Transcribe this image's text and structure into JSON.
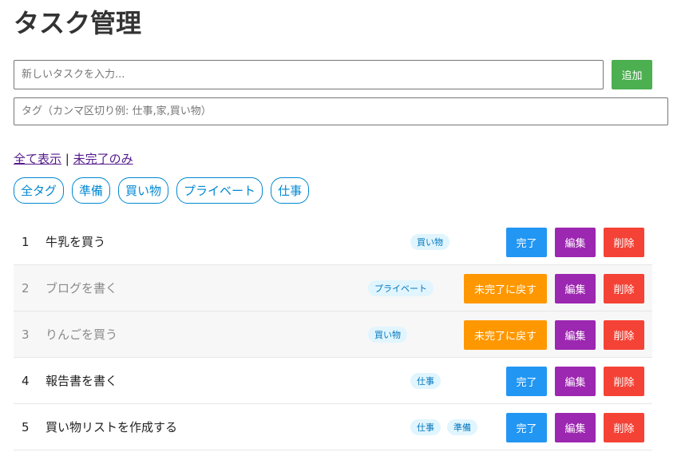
{
  "app": {
    "title": "タスク管理"
  },
  "form": {
    "task_placeholder": "新しいタスクを入力...",
    "tag_placeholder": "タグ（カンマ区切り例: 仕事,家,買い物）",
    "add_label": "追加"
  },
  "filters": {
    "all_label": "全て表示",
    "separator": "|",
    "incomplete_label": "未完了のみ"
  },
  "tag_filters": [
    "全タグ",
    "準備",
    "買い物",
    "プライベート",
    "仕事"
  ],
  "tasks": [
    {
      "num": "1",
      "text": "牛乳を買う",
      "done": false,
      "tags": [
        "買い物"
      ],
      "action_label": "完了",
      "edit_label": "編集",
      "delete_label": "削除"
    },
    {
      "num": "2",
      "text": "ブログを書く",
      "done": true,
      "tags": [
        "プライベート"
      ],
      "action_label": "未完了に戻す",
      "edit_label": "編集",
      "delete_label": "削除"
    },
    {
      "num": "3",
      "text": "りんごを買う",
      "done": true,
      "tags": [
        "買い物"
      ],
      "action_label": "未完了に戻す",
      "edit_label": "編集",
      "delete_label": "削除"
    },
    {
      "num": "4",
      "text": "報告書を書く",
      "done": false,
      "tags": [
        "仕事"
      ],
      "action_label": "完了",
      "edit_label": "編集",
      "delete_label": "削除"
    },
    {
      "num": "5",
      "text": "買い物リストを作成する",
      "done": false,
      "tags": [
        "仕事",
        "準備"
      ],
      "action_label": "完了",
      "edit_label": "編集",
      "delete_label": "削除"
    }
  ],
  "colors": {
    "add": "#4caf50",
    "complete": "#2196f3",
    "undo": "#ff9800",
    "edit": "#9c27b0",
    "delete": "#f44336",
    "tag_accent": "#0288d1"
  }
}
